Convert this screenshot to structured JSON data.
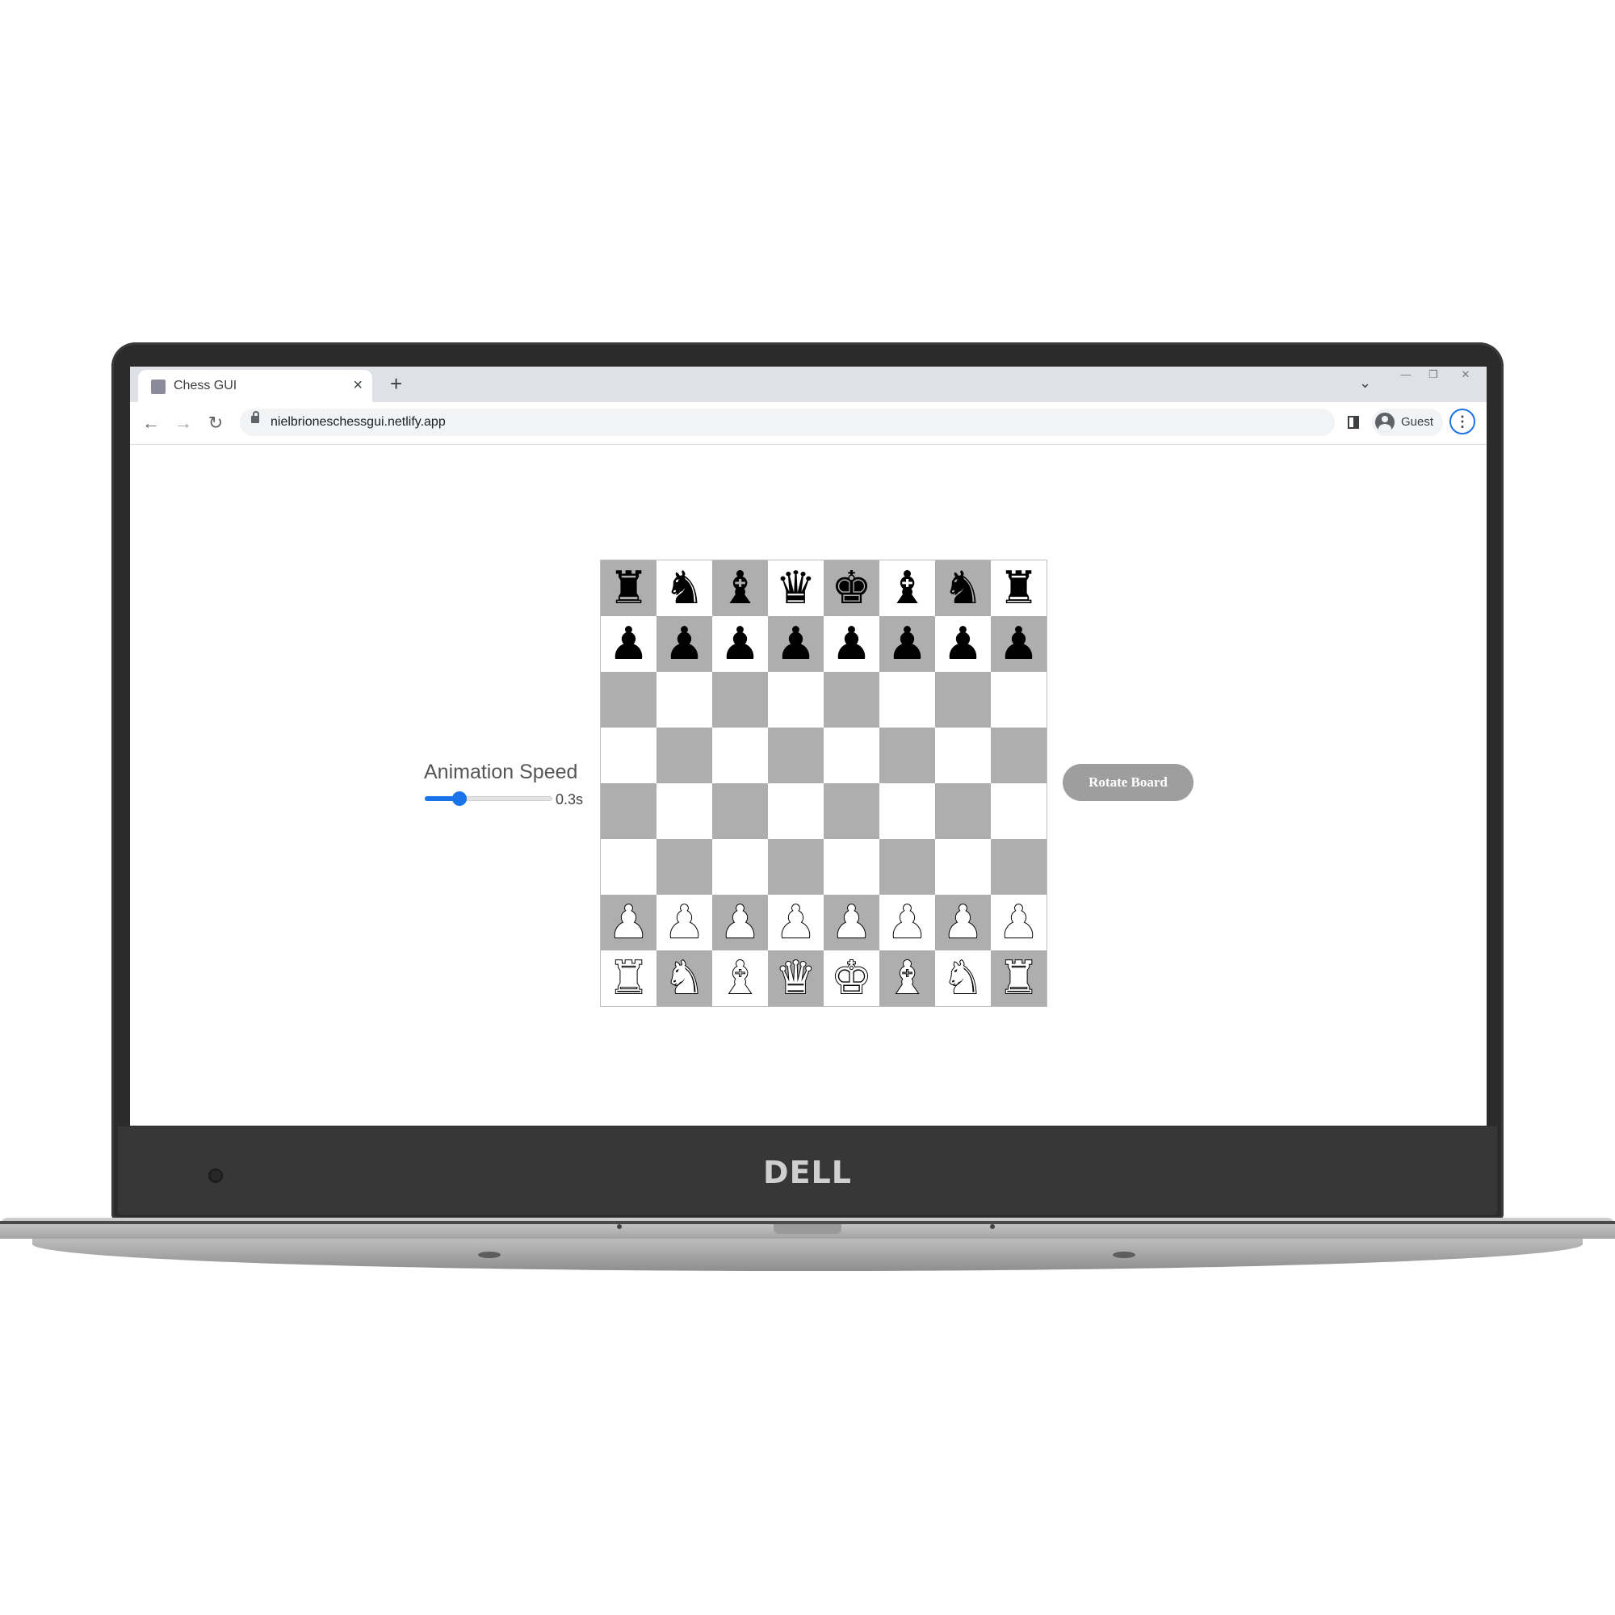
{
  "browser": {
    "tab_title": "Chess GUI",
    "tab_close": "×",
    "new_tab": "+",
    "tab_search": "⌄",
    "url": "nielbrioneschessgui.netlify.app",
    "back": "←",
    "forward": "→",
    "reload": "↻",
    "profile_label": "Guest",
    "menu": "⋮",
    "window_minimize": "—",
    "window_restore": "❐",
    "window_close": "✕"
  },
  "controls": {
    "animation_speed_label": "Animation Speed",
    "animation_speed_value": "0.3s",
    "animation_speed_fraction": 0.27,
    "rotate_button_label": "Rotate Board"
  },
  "board": {
    "light_square_color": "#ffffff",
    "dark_square_color": "#aeaeae",
    "top_left_is_dark": true,
    "rows": [
      [
        "br",
        "bn",
        "bb",
        "bq",
        "bk",
        "bb",
        "bn",
        "br"
      ],
      [
        "bp",
        "bp",
        "bp",
        "bp",
        "bp",
        "bp",
        "bp",
        "bp"
      ],
      [
        "",
        "",
        "",
        "",
        "",
        "",
        "",
        ""
      ],
      [
        "",
        "",
        "",
        "",
        "",
        "",
        "",
        ""
      ],
      [
        "",
        "",
        "",
        "",
        "",
        "",
        "",
        ""
      ],
      [
        "",
        "",
        "",
        "",
        "",
        "",
        "",
        ""
      ],
      [
        "wp",
        "wp",
        "wp",
        "wp",
        "wp",
        "wp",
        "wp",
        "wp"
      ],
      [
        "wr",
        "wn",
        "wb",
        "wq",
        "wk",
        "wb",
        "wn",
        "wr"
      ]
    ]
  },
  "laptop": {
    "brand": "DELL"
  }
}
